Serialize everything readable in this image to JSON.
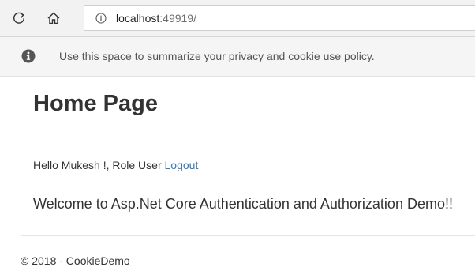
{
  "browser": {
    "url_host": "localhost",
    "url_port": ":49919/",
    "refresh_icon": "refresh-icon",
    "home_icon": "home-icon",
    "site_info_icon": "info-circle-icon"
  },
  "consent": {
    "icon": "info-sign-icon",
    "message": "Use this space to summarize your privacy and cookie use policy."
  },
  "main": {
    "title": "Home Page",
    "greeting": {
      "prefix": "Hello Mukesh !, Role User",
      "logout_label": "Logout"
    },
    "welcome": "Welcome to Asp.Net Core Authentication and Authorization Demo!!"
  },
  "footer": {
    "text": "© 2018 - CookieDemo"
  },
  "colors": {
    "link": "#337ab7",
    "text": "#333333",
    "toolbar_bg": "#f2f2f2",
    "consent_bg": "#f5f5f5"
  }
}
